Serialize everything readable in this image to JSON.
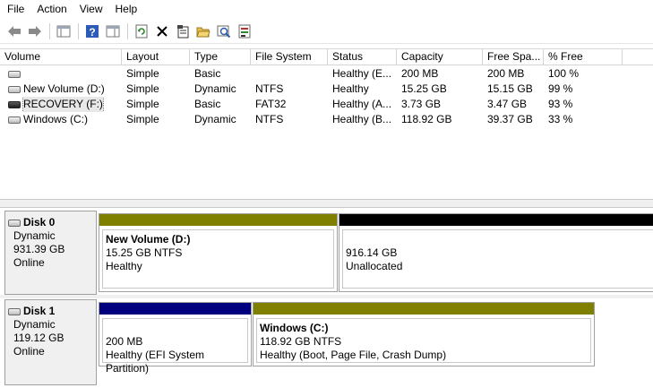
{
  "menu": [
    "File",
    "Action",
    "View",
    "Help"
  ],
  "toolbar": {
    "icons": [
      "back-arrow-icon",
      "forward-arrow-icon",
      "console-tree-icon",
      "help-icon",
      "show-hide-pane-icon",
      "refresh-icon",
      "delete-icon",
      "properties-icon",
      "open-folder-icon",
      "explore-icon",
      "rescan-disks-icon"
    ]
  },
  "colors": {
    "primary_partition": "#808000",
    "unallocated": "#000000",
    "efi_partition": "#00007f",
    "panel_bg": "#f0f0f0"
  },
  "volumes": {
    "columns": [
      "Volume",
      "Layout",
      "Type",
      "File System",
      "Status",
      "Capacity",
      "Free Spa...",
      "% Free"
    ],
    "rows": [
      {
        "volume": "",
        "layout": "Simple",
        "type": "Basic",
        "fs": "",
        "status": "Healthy (E...",
        "capacity": "200 MB",
        "free": "200 MB",
        "pct": "100 %"
      },
      {
        "volume": "New Volume (D:)",
        "layout": "Simple",
        "type": "Dynamic",
        "fs": "NTFS",
        "status": "Healthy",
        "capacity": "15.25 GB",
        "free": "15.15 GB",
        "pct": "99 %"
      },
      {
        "volume": "RECOVERY (F:)",
        "layout": "Simple",
        "type": "Basic",
        "fs": "FAT32",
        "status": "Healthy (A...",
        "capacity": "3.73 GB",
        "free": "3.47 GB",
        "pct": "93 %"
      },
      {
        "volume": "Windows (C:)",
        "layout": "Simple",
        "type": "Dynamic",
        "fs": "NTFS",
        "status": "Healthy (B...",
        "capacity": "118.92 GB",
        "free": "39.37 GB",
        "pct": "33 %"
      }
    ]
  },
  "disks": [
    {
      "name": "Disk 0",
      "kind": "Dynamic",
      "size": "931.39 GB",
      "state": "Online",
      "partitions": [
        {
          "title": "New Volume  (D:)",
          "line1": "15.25 GB NTFS",
          "line2": "Healthy",
          "color": "#808000"
        },
        {
          "title": "",
          "line1": "916.14 GB",
          "line2": "Unallocated",
          "color": "#000000"
        }
      ]
    },
    {
      "name": "Disk 1",
      "kind": "Dynamic",
      "size": "119.12 GB",
      "state": "Online",
      "partitions": [
        {
          "title": "",
          "line1": "200 MB",
          "line2": "Healthy (EFI System Partition)",
          "color": "#00007f"
        },
        {
          "title": "Windows  (C:)",
          "line1": "118.92 GB NTFS",
          "line2": "Healthy (Boot, Page File, Crash Dump)",
          "color": "#808000"
        }
      ]
    }
  ]
}
